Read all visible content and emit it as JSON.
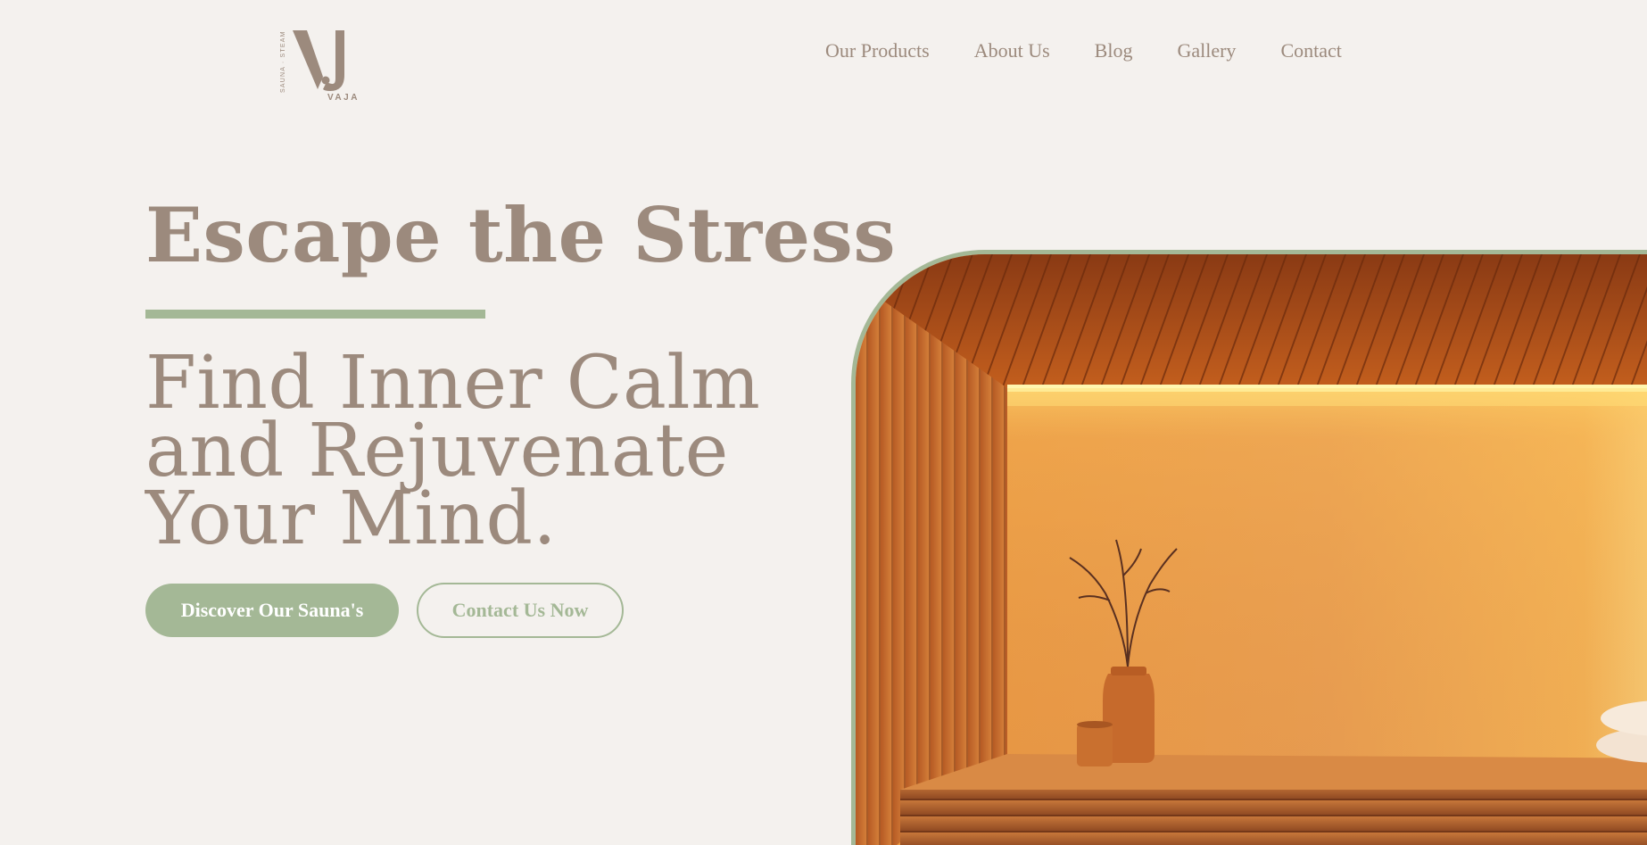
{
  "brand": {
    "logo_mark": "VJ",
    "logo_tagline": "SAUNA · STEAM",
    "logo_name": "VAJA"
  },
  "nav": {
    "items": [
      {
        "label": "Our Products"
      },
      {
        "label": "About Us"
      },
      {
        "label": "Blog"
      },
      {
        "label": "Gallery"
      },
      {
        "label": "Contact"
      }
    ]
  },
  "hero": {
    "title": "Escape the Stress",
    "subtitle_lines": [
      "Find Inner Calm",
      "and Rejuvenate",
      "Your Mind."
    ],
    "primary_cta": "Discover Our Sauna's",
    "secondary_cta": "Contact Us Now",
    "image_icon": "sauna-interior-image"
  },
  "colors": {
    "background": "#f4f1ee",
    "text_brown": "#9c8a7d",
    "accent_green": "#a4b896",
    "button_text": "#ffffff"
  }
}
